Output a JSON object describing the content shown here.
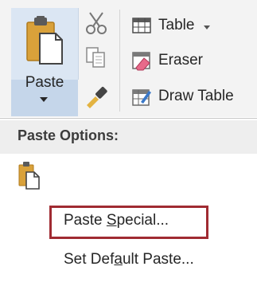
{
  "ribbon": {
    "paste_label": "Paste",
    "table_label": "Table",
    "eraser_label": "Eraser",
    "draw_table_label": "Draw Table"
  },
  "menu": {
    "header": "Paste Options:",
    "paste_special": {
      "prefix": "Paste ",
      "accel": "S",
      "suffix": "pecial..."
    },
    "set_default": {
      "prefix": "Set Def",
      "accel": "a",
      "suffix": "ult Paste..."
    }
  },
  "colors": {
    "highlight": "#a02b32",
    "paste_bg": "#dbe6f3"
  },
  "icons": [
    "clipboard-icon",
    "cut-icon",
    "copy-icon",
    "format-painter-icon",
    "table-icon",
    "eraser-icon",
    "draw-table-icon",
    "keep-source-formatting-icon"
  ]
}
